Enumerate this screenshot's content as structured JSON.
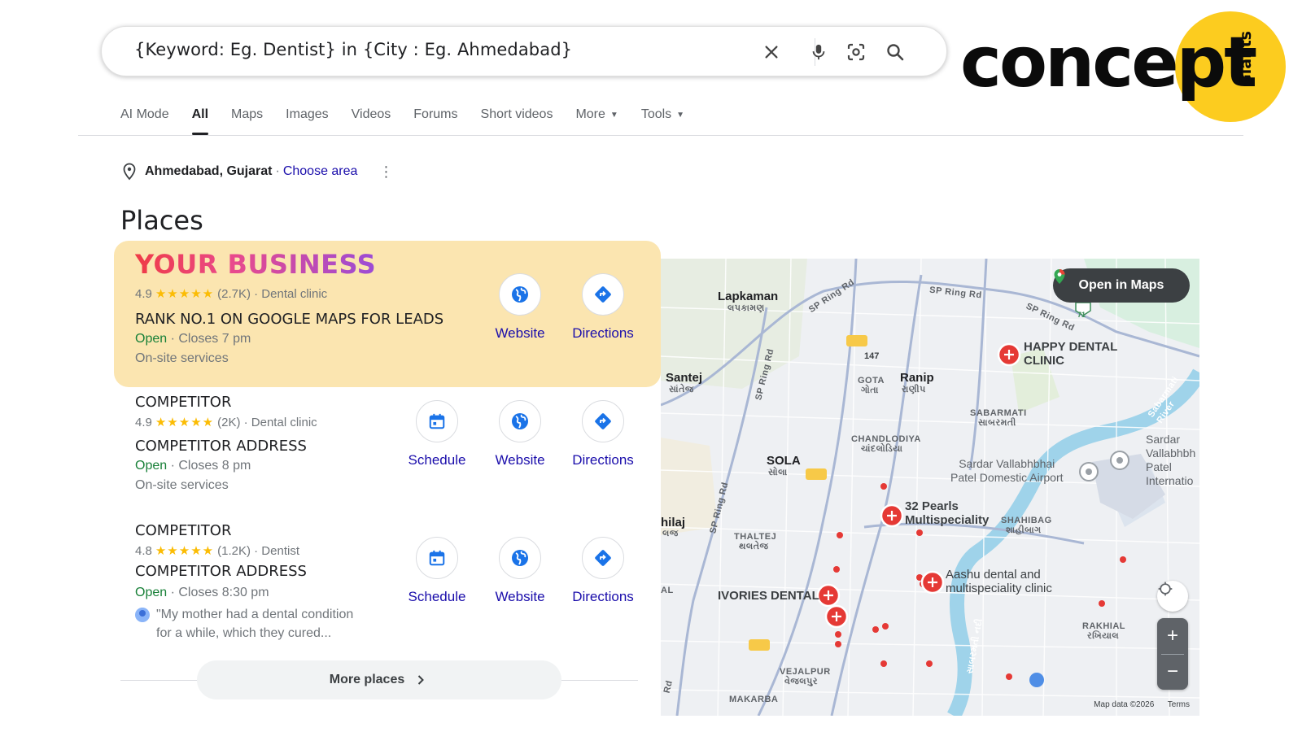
{
  "search": {
    "query": "{Keyword: Eg. Dentist} in {City : Eg. Ahmedabad}"
  },
  "logo": {
    "word": "concept",
    "sub": "Giants"
  },
  "tabs": [
    {
      "label": "AI Mode"
    },
    {
      "label": "All"
    },
    {
      "label": "Maps"
    },
    {
      "label": "Images"
    },
    {
      "label": "Videos"
    },
    {
      "label": "Forums"
    },
    {
      "label": "Short videos"
    },
    {
      "label": "More"
    },
    {
      "label": "Tools"
    }
  ],
  "location": {
    "place": "Ahmedabad, Gujarat",
    "separator": "·",
    "choose": "Choose area"
  },
  "places_title": "Places",
  "highlight_label": "YOUR BUSINESS",
  "listings": [
    {
      "rating": "4.9",
      "stars": "★★★★★",
      "reviews": "(2.7K)",
      "category": "· Dental clinic",
      "address": "RANK NO.1 ON GOOGLE MAPS FOR LEADS",
      "open": "Open",
      "closes": "· Closes 7 pm",
      "service": "On-site services",
      "website_label": "Website",
      "directions_label": "Directions"
    },
    {
      "name": "COMPETITOR",
      "rating": "4.9",
      "stars": "★★★★★",
      "reviews": "(2K)",
      "category": "· Dental clinic",
      "address": "COMPETITOR ADDRESS",
      "open": "Open",
      "closes": "· Closes 8 pm",
      "service": "On-site services",
      "schedule_label": "Schedule",
      "website_label": "Website",
      "directions_label": "Directions"
    },
    {
      "name": "COMPETITOR",
      "rating": "4.8",
      "stars": "★★★★★",
      "reviews": "(1.2K)",
      "category": "· Dentist",
      "address": "COMPETITOR ADDRESS",
      "open": "Open",
      "closes": "· Closes 8:30 pm",
      "review_line1": "\"My mother had a dental condition",
      "review_line2": "for a while, which they cured...",
      "schedule_label": "Schedule",
      "website_label": "Website",
      "directions_label": "Directions"
    }
  ],
  "more_places": "More places",
  "map": {
    "open_in_maps": "Open in Maps",
    "labels": {
      "lapkaman": "Lapkaman",
      "lapkaman_gu": "લપકામણ",
      "santej": "Santej",
      "santej_gu": "સાંતેજ",
      "gota": "GOTA",
      "gota_gu": "ગોતા",
      "ranip": "Ranip",
      "ranip_gu": "રાણીપ",
      "sabarmati": "SABARMATI",
      "sabarmati_gu": "સાબરમતી",
      "chandlodiya": "CHANDLODIYA",
      "chandlodiya_gu": "ચાંદલોડિયા",
      "sola": "SOLA",
      "sola_gu": "સોલા",
      "thaltej": "THALTEJ",
      "thaltej_gu": "થલતેજ",
      "shahibag": "SHAHIBAG",
      "shahibag_gu": "શાહીબાગ",
      "vejalpur": "VEJALPUR",
      "vejalpur_gu": "વેજલપુર",
      "makarba": "MAKARBA",
      "rakhial": "RAKHIAL",
      "rakhial_gu": "રખિયાલ",
      "airport": "Sardar Vallabhbhai\nPatel Domestic Airport",
      "airport_intl": "Sardar\nVallabhbh\nPatel\nInternatio",
      "hilaj": "hilaj",
      "hilaj_gu": "લજ",
      "al": "AL",
      "happy_dental": "HAPPY DENTAL\nCLINIC",
      "pearls": "32 Pearls\nMultispeciality",
      "ivories": "IVORIES DENTAL",
      "aashu": "Aashu dental and\nmultispeciality clinic",
      "sp_ring_rd": "SP Ring Rd",
      "sabarmati_river": "Sabarmati River",
      "sabarmati_river_gu": "સાબરમતી નદી",
      "route_147": "147",
      "route_71": "71",
      "rd": "Rd"
    },
    "footer_data": "Map data ©2026",
    "footer_terms": "Terms"
  },
  "colors": {
    "highlight_bg": "#fbe5b0",
    "link_blue": "#1a0dab",
    "open_green": "#188038",
    "star_yellow": "#fbbc04",
    "logo_yellow": "#fccc1f",
    "pin_red": "#e53935"
  }
}
